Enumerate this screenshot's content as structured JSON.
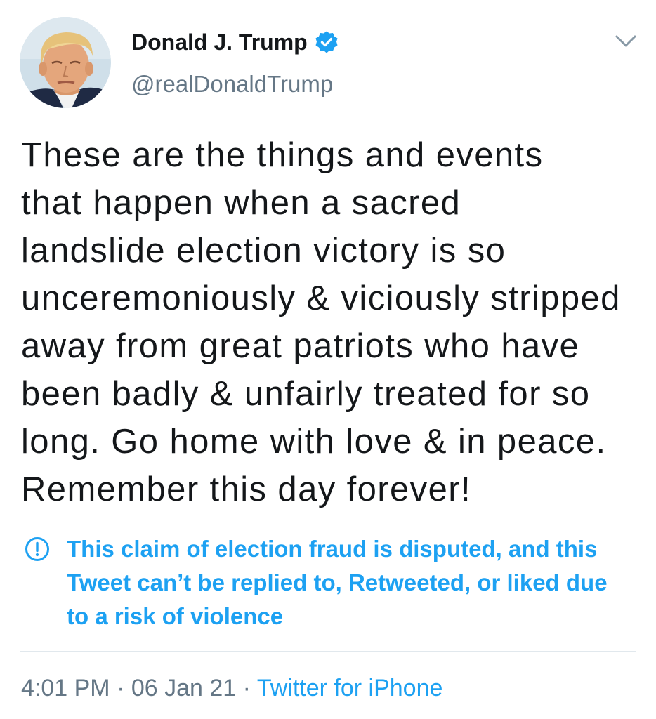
{
  "author": {
    "name": "Donald J. Trump",
    "handle": "@realDonaldTrump",
    "verified": true,
    "avatar_icon": "profile-photo"
  },
  "icons": {
    "verified": "verified-badge-icon",
    "menu": "chevron-down-icon",
    "notice": "exclamation-circle-icon"
  },
  "tweet": {
    "text_lines": [
      "These are the things and events",
      "that happen when a sacred",
      "landslide election victory is so",
      "unceremoniously & viciously stripped",
      "away from great patriots who have",
      "been badly & unfairly treated for so",
      "long. Go home with love & in peace.",
      "Remember this day forever!"
    ]
  },
  "notice": {
    "lines": [
      "This claim of election fraud is disputed, and this",
      "Tweet can’t be replied to, Retweeted, or liked due",
      "to a risk of violence"
    ]
  },
  "meta": {
    "time": "4:01 PM",
    "separator": "·",
    "date": "06 Jan 21",
    "source": "Twitter for iPhone"
  },
  "colors": {
    "text": "#14171a",
    "accent": "#1da1f2",
    "secondary": "#657786",
    "divider": "#e1e8ed",
    "chevron": "#8899a6"
  }
}
